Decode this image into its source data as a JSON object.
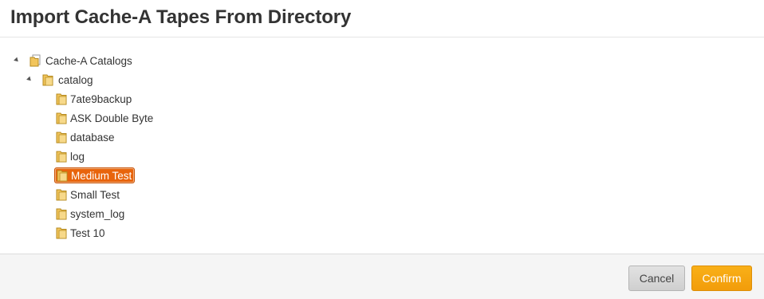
{
  "dialog": {
    "title": "Import Cache-A Tapes From Directory"
  },
  "tree": {
    "root": {
      "label": "Cache-A Catalogs",
      "icon": "catalog-folder-icon",
      "expanded": true
    },
    "catalog": {
      "label": "catalog",
      "icon": "folder-icon",
      "expanded": true
    },
    "items": [
      {
        "label": "7ate9backup",
        "icon": "folder-icon",
        "selected": false
      },
      {
        "label": "ASK Double Byte",
        "icon": "folder-icon",
        "selected": false
      },
      {
        "label": "database",
        "icon": "folder-icon",
        "selected": false
      },
      {
        "label": "log",
        "icon": "folder-icon",
        "selected": false
      },
      {
        "label": "Medium Test",
        "icon": "folder-icon",
        "selected": true
      },
      {
        "label": "Small Test",
        "icon": "folder-icon",
        "selected": false
      },
      {
        "label": "system_log",
        "icon": "folder-icon",
        "selected": false
      },
      {
        "label": "Test 10",
        "icon": "folder-icon",
        "selected": false
      }
    ]
  },
  "footer": {
    "cancel_label": "Cancel",
    "confirm_label": "Confirm"
  },
  "colors": {
    "selection": "#e8640c",
    "confirm": "#f4a20f",
    "folder": "#f2c55c"
  }
}
